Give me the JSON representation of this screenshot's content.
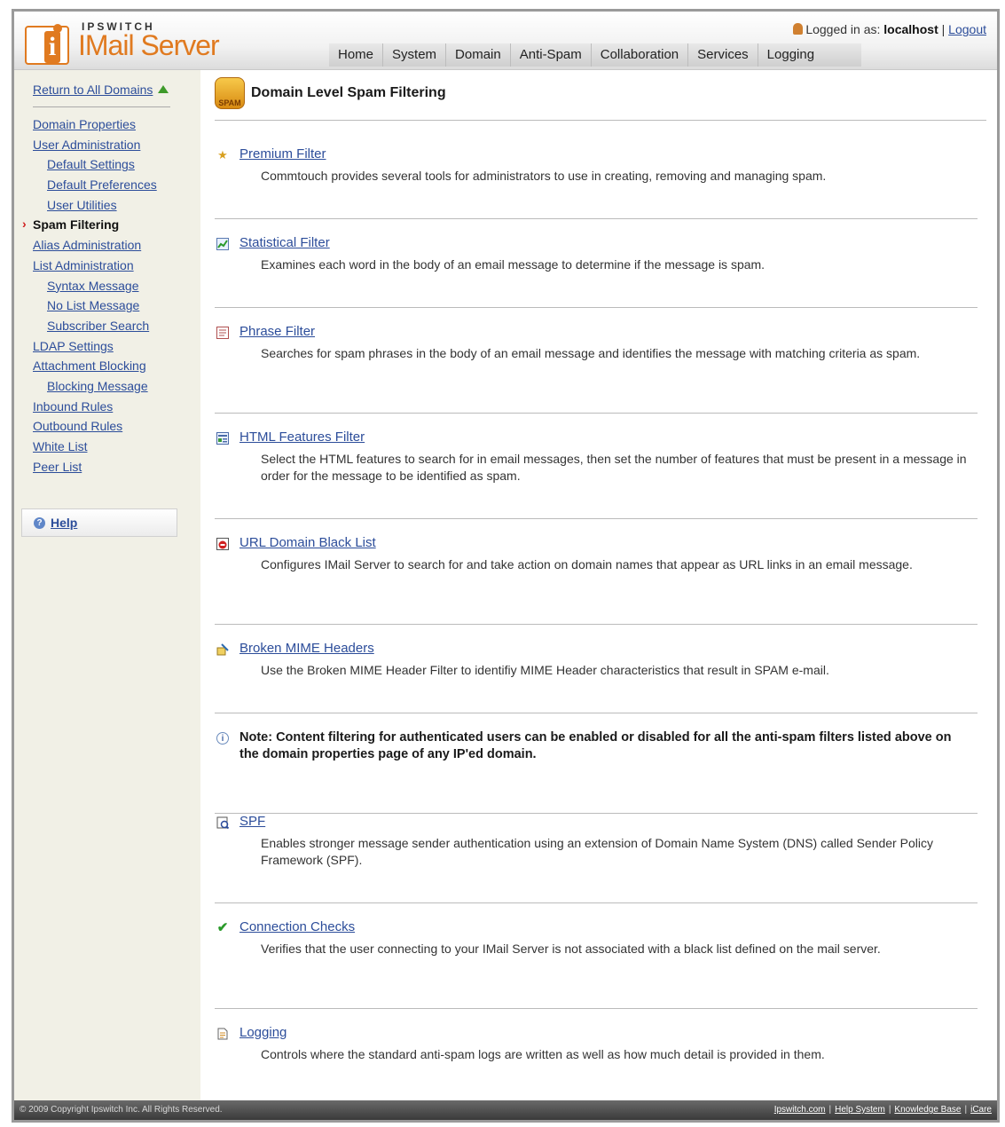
{
  "header": {
    "brand_top": "IPSWITCH",
    "brand_main": "IMail Server",
    "logged_in_label": "Logged in as:",
    "username": "localhost",
    "logout_label": "Logout",
    "nav": [
      "Home",
      "System",
      "Domain",
      "Anti-Spam",
      "Collaboration",
      "Services",
      "Logging"
    ]
  },
  "sidebar": {
    "return_label": "Return to All Domains",
    "items": [
      {
        "label": "Domain Properties"
      },
      {
        "label": "User Administration"
      },
      {
        "label": "Default Settings"
      },
      {
        "label": "Default Preferences"
      },
      {
        "label": "User Utilities"
      },
      {
        "label": "Spam Filtering"
      },
      {
        "label": "Alias Administration"
      },
      {
        "label": "List Administration"
      },
      {
        "label": "Syntax Message"
      },
      {
        "label": "No List Message"
      },
      {
        "label": "Subscriber Search"
      },
      {
        "label": "LDAP Settings"
      },
      {
        "label": "Attachment Blocking"
      },
      {
        "label": "Blocking Message"
      },
      {
        "label": "Inbound Rules"
      },
      {
        "label": "Outbound Rules"
      },
      {
        "label": "White List"
      },
      {
        "label": "Peer List"
      }
    ],
    "help_label": "Help"
  },
  "main": {
    "title": "Domain Level Spam Filtering",
    "spam_icon_label": "SPAM",
    "features": [
      {
        "title": "Premium Filter",
        "desc": "Commtouch provides several tools for administrators to use in creating, removing and managing spam."
      },
      {
        "title": "Statistical Filter",
        "desc": "Examines each word in the body of an email message to determine if the message is spam."
      },
      {
        "title": "Phrase Filter",
        "desc": "Searches for spam phrases in the body of an email message and identifies the message with matching criteria as spam."
      },
      {
        "title": "HTML Features Filter",
        "desc": "Select the HTML features to search for in email messages, then set the number of features that must be present in a message in order for the message to be identified as spam."
      },
      {
        "title": "URL Domain Black List",
        "desc": "Configures IMail Server to search for and take action on domain names that appear as URL links in an email message."
      },
      {
        "title": "Broken MIME Headers",
        "desc": "Use the Broken MIME Header Filter to identifiy MIME Header characteristics that result in SPAM e-mail."
      }
    ],
    "note": "Note: Content filtering for authenticated users can be enabled or disabled for all the anti-spam filters listed above on the domain properties page of any IP'ed domain.",
    "features2": [
      {
        "title": "SPF",
        "desc": "Enables stronger message sender authentication using an extension of Domain Name System (DNS) called Sender Policy Framework (SPF)."
      },
      {
        "title": "Connection Checks",
        "desc": "Verifies that the user connecting to your IMail Server is not associated with a black list defined on the mail server."
      },
      {
        "title": "Logging",
        "desc": "Controls where the standard anti-spam logs are written as well as how much detail is provided in them."
      }
    ]
  },
  "footer": {
    "copyright": "© 2009 Copyright Ipswitch Inc. All Rights Reserved.",
    "links": [
      "Ipswitch.com",
      "Help System",
      "Knowledge Base",
      "iCare"
    ]
  }
}
